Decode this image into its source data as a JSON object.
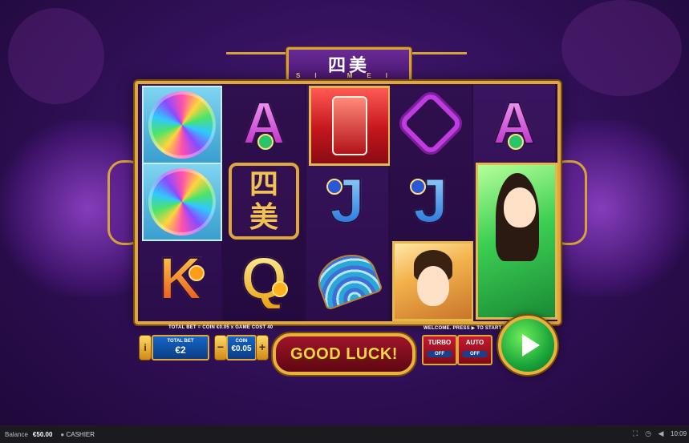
{
  "game": {
    "title_cn": "四美",
    "title_en": "SI MEI",
    "logo_symbol": "四\n美"
  },
  "reels": [
    [
      "umbrella-symbol",
      "umbrella-symbol",
      "K"
    ],
    [
      "A",
      "si-mei-logo",
      "Q"
    ],
    [
      "red-robe-symbol",
      "J",
      "fan-symbol"
    ],
    [
      "knot-symbol",
      "J",
      "golden-lady-symbol"
    ],
    [
      "A",
      "green-lady-symbol",
      "green-lady-symbol"
    ]
  ],
  "letters": {
    "a": "A",
    "j": "J",
    "k": "K",
    "q": "Q"
  },
  "controls": {
    "total_bet_info": "TOTAL BET = COIN €0.05 x GAME COST 40",
    "info_button": "i",
    "total_bet_label": "TOTAL BET",
    "total_bet_value": "€2",
    "coin_label": "COIN",
    "coin_value": "€0.05",
    "coin_minus": "−",
    "coin_plus": "+",
    "good_luck": "GOOD LUCK!",
    "welcome": "WELCOME. PRESS ▶ TO START",
    "turbo_label": "TURBO",
    "turbo_state": "OFF",
    "auto_label": "AUTO",
    "auto_state": "OFF"
  },
  "bottom_bar": {
    "balance_label": "Balance",
    "balance_value": "€50.00",
    "cashier_label": "CASHIER",
    "clock": "10:09"
  },
  "icons": [
    "fullscreen-icon",
    "history-icon",
    "sound-icon",
    "cashier-icon",
    "play-icon"
  ],
  "colors": {
    "gold": "#e0a83c",
    "purple": "#2f0f55",
    "spin_green": "#1aa53a",
    "goodluck_red": "#a0142a"
  }
}
